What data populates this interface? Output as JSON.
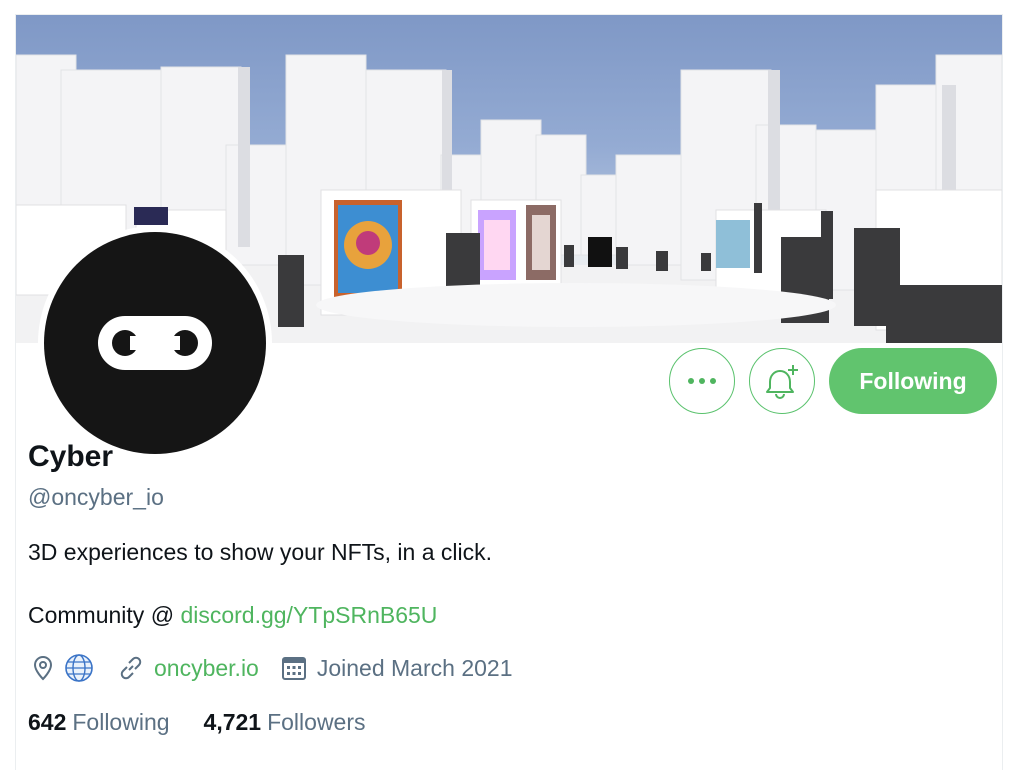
{
  "profile": {
    "name": "Cyber",
    "handle": "@oncyber_io",
    "bio": "3D experiences to show your NFTs, in a click.",
    "bio_community_prefix": "Community @ ",
    "bio_community_link": "discord.gg/YTpSRnB65U",
    "website": "oncyber.io",
    "joined": "Joined March 2021",
    "following_count": "642",
    "following_label": "Following",
    "followers_count": "4,721",
    "followers_label": "Followers"
  },
  "actions": {
    "follow_button_label": "Following",
    "more_icon": "more-dots-icon",
    "notify_icon": "bell-plus-icon"
  },
  "meta_icons": [
    "location-pin-icon",
    "globe-icon",
    "link-icon",
    "calendar-icon"
  ],
  "colors": {
    "accent": "#61c46e",
    "link": "#4fb55f",
    "secondary_text": "#5b7083",
    "avatar_bg": "#151515",
    "banner_sky": "#7f98c6"
  }
}
